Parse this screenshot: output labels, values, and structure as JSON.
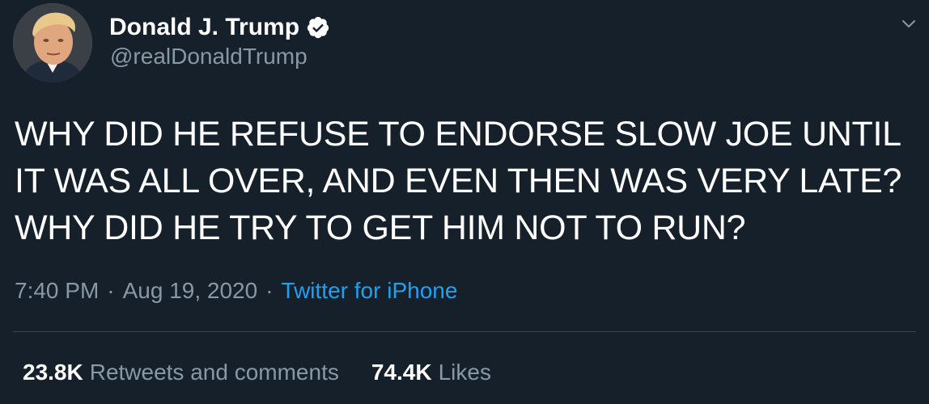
{
  "user": {
    "display_name": "Donald J. Trump",
    "handle": "@realDonaldTrump",
    "verified": true,
    "avatar_icon": "profile-photo-icon"
  },
  "tweet": {
    "text": "WHY DID HE REFUSE TO ENDORSE SLOW JOE UNTIL IT WAS ALL OVER, AND EVEN THEN WAS VERY LATE? WHY DID HE TRY TO GET HIM NOT TO RUN?",
    "time": "7:40 PM",
    "date": "Aug 19, 2020",
    "separator": "·",
    "source": "Twitter for iPhone"
  },
  "stats": {
    "retweets_count": "23.8K",
    "retweets_label": "Retweets and comments",
    "likes_count": "74.4K",
    "likes_label": "Likes"
  },
  "menu_icon": "chevron-down-icon",
  "colors": {
    "background": "#15202b",
    "primary_text": "#ffffff",
    "secondary_text": "#8899a6",
    "link": "#1da1f2",
    "divider": "#38444d"
  }
}
